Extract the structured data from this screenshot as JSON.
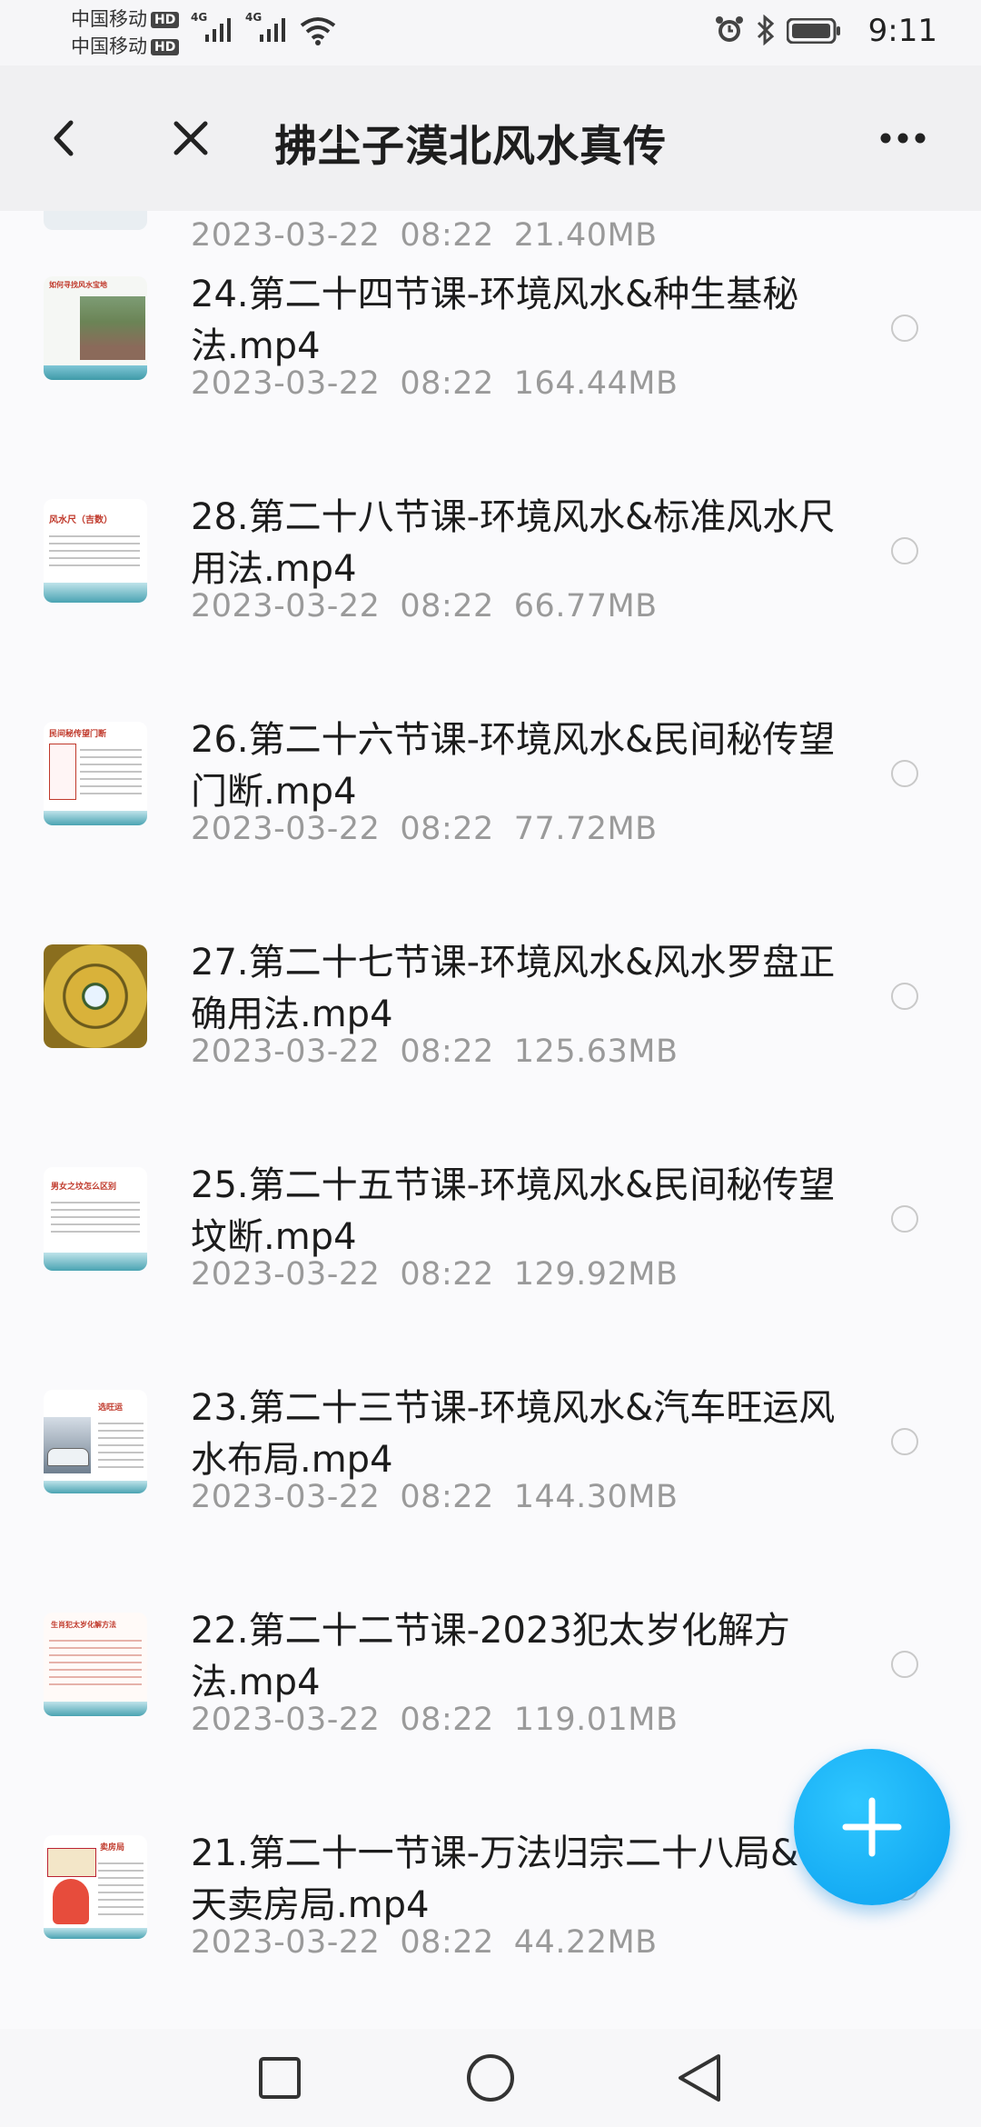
{
  "status_bar": {
    "carrier1": "中国移动",
    "carrier2": "中国移动",
    "hd_badge": "HD",
    "network1": "4G",
    "network2": "4G",
    "time": "9:11",
    "icons": [
      "alarm-icon",
      "bluetooth-icon",
      "battery-icon",
      "wifi-icon",
      "signal-icon"
    ]
  },
  "header": {
    "title": "拂尘子漠北风水真传",
    "icons": [
      "back-arrow-icon",
      "close-icon",
      "more-icon"
    ]
  },
  "files": [
    {
      "name": "",
      "date": "2023-03-22",
      "time": "08:22",
      "size": "21.40MB"
    },
    {
      "name": "24.第二十四节课-环境风水&种生基秘法.mp4",
      "date": "2023-03-22",
      "time": "08:22",
      "size": "164.44MB"
    },
    {
      "name": "28.第二十八节课-环境风水&标准风水尺用法.mp4",
      "date": "2023-03-22",
      "time": "08:22",
      "size": "66.77MB"
    },
    {
      "name": "26.第二十六节课-环境风水&民间秘传望门断.mp4",
      "date": "2023-03-22",
      "time": "08:22",
      "size": "77.72MB"
    },
    {
      "name": "27.第二十七节课-环境风水&风水罗盘正确用法.mp4",
      "date": "2023-03-22",
      "time": "08:22",
      "size": "125.63MB"
    },
    {
      "name": "25.第二十五节课-环境风水&民间秘传望坟断.mp4",
      "date": "2023-03-22",
      "time": "08:22",
      "size": "129.92MB"
    },
    {
      "name": "23.第二十三节课-环境风水&汽车旺运风水布局.mp4",
      "date": "2023-03-22",
      "time": "08:22",
      "size": "144.30MB"
    },
    {
      "name": "22.第二十二节课-2023犯太岁化解方法.mp4",
      "date": "2023-03-22",
      "time": "08:22",
      "size": "119.01MB"
    },
    {
      "name": "21.第二十一节课-万法归宗二十八局&七天卖房局.mp4",
      "date": "2023-03-22",
      "time": "08:22",
      "size": "44.22MB"
    }
  ],
  "thumbnails": [
    {
      "caption": "",
      "accent": "#d6dde2"
    },
    {
      "caption": "如何寻找风水宝地",
      "accent": "#c0392b"
    },
    {
      "caption": "风水尺（吉数）",
      "accent": "#c0392b"
    },
    {
      "caption": "民间秘传望门断",
      "accent": "#c0392b"
    },
    {
      "caption": "",
      "accent": "#c9a227"
    },
    {
      "caption": "男女之坟怎么区别",
      "accent": "#c0392b"
    },
    {
      "caption": "选旺运",
      "accent": "#c0392b"
    },
    {
      "caption": "生肖犯太岁化解方法",
      "accent": "#c0392b"
    },
    {
      "caption": "卖房局",
      "accent": "#c0392b"
    }
  ],
  "colors": {
    "fab": "#0aa0ef",
    "meta_text": "#9a9a9a"
  },
  "fab": {
    "icon": "plus-icon"
  },
  "nav": {
    "icons": [
      "square-recent-icon",
      "circle-home-icon",
      "triangle-back-icon"
    ]
  }
}
